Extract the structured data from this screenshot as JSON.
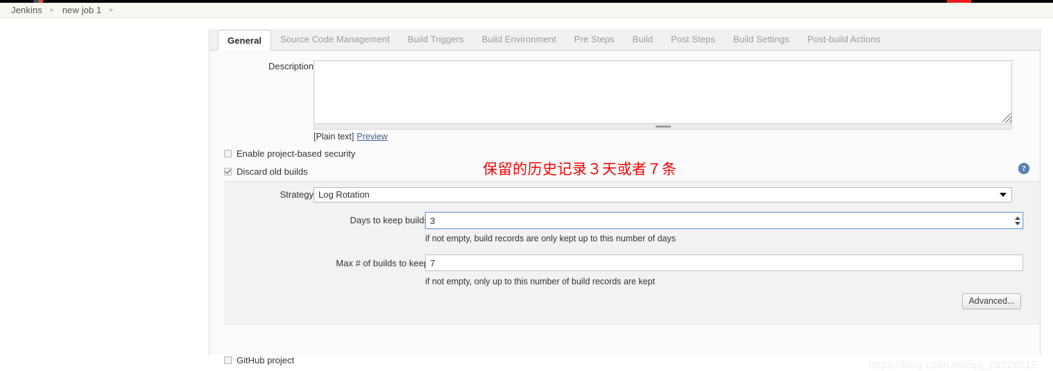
{
  "breadcrumb": {
    "items": [
      {
        "label": "Jenkins"
      },
      {
        "label": "new job 1"
      }
    ],
    "separator": "▸"
  },
  "tabs": [
    {
      "label": "General",
      "active": true
    },
    {
      "label": "Source Code Management",
      "active": false
    },
    {
      "label": "Build Triggers",
      "active": false
    },
    {
      "label": "Build Environment",
      "active": false
    },
    {
      "label": "Pre Steps",
      "active": false
    },
    {
      "label": "Build",
      "active": false
    },
    {
      "label": "Post Steps",
      "active": false
    },
    {
      "label": "Build Settings",
      "active": false
    },
    {
      "label": "Post-build Actions",
      "active": false
    }
  ],
  "form": {
    "description": {
      "label": "Description",
      "value": "",
      "placeholder": "",
      "plain_text_label": "[Plain text]",
      "preview_link": "Preview"
    },
    "enable_security": {
      "label": "Enable project-based security",
      "checked": false
    },
    "discard_old_builds": {
      "label": "Discard old builds",
      "checked": true,
      "help_icon": "question-mark-icon"
    },
    "strategy": {
      "label": "Strategy",
      "selected": "Log Rotation",
      "options": [
        "Log Rotation"
      ]
    },
    "days_to_keep": {
      "label": "Days to keep builds",
      "value": "3",
      "help": "if not empty, build records are only kept up to this number of days"
    },
    "max_builds_to_keep": {
      "label": "Max # of builds to keep",
      "value": "7",
      "help": "if not empty, only up to this number of build records are kept"
    },
    "advanced_button": "Advanced...",
    "github_project": {
      "label": "GitHub project",
      "checked": false
    }
  },
  "annotation": {
    "red_note": "保留的历史记录３天或者７条"
  },
  "watermark": "https://blog.csdn.net/qq_28226519",
  "colors": {
    "accent_red": "#ff0000",
    "link_blue": "#3a5f8f",
    "help_blue": "#5b86b8",
    "focus_blue": "#7aa8e0"
  }
}
